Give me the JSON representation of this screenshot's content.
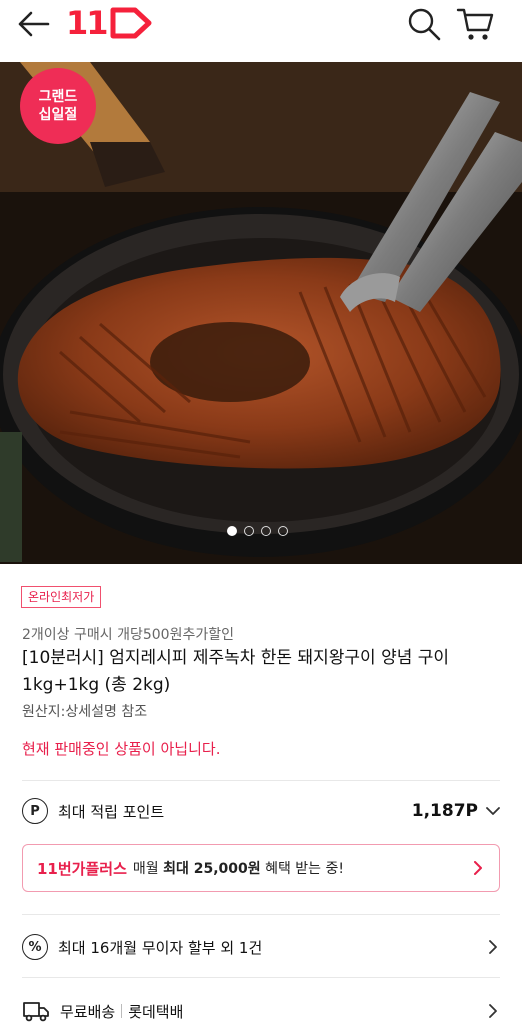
{
  "header": {
    "logo_text": "11",
    "back_icon": "back-arrow-icon",
    "search_icon": "search-icon",
    "cart_icon": "cart-icon"
  },
  "hero": {
    "badge_line1": "그랜드",
    "badge_line2": "십일절",
    "image_count": 4,
    "active_index": 0
  },
  "product": {
    "lowest_tag": "온라인최저가",
    "promo": "2개이상 구매시 개당500원추가할인",
    "title": "[10분러시] 엄지레시피 제주녹차 한돈 돼지왕구이 양념 구이 1kg+1kg (총 2kg)",
    "origin": "원산지:상세설명 참조",
    "status": "현재 판매중인 상품이 아닙니다."
  },
  "points": {
    "icon_text": "P",
    "label": "최대 적립 포인트",
    "value": "1,187P"
  },
  "plus": {
    "brand": "11번가플러스",
    "text_prefix": "매월",
    "text_bold": "최대 25,000원",
    "text_suffix": "혜택 받는 중!"
  },
  "installment": {
    "icon_text": "%",
    "label": "최대 16개월 무이자 할부 외 1건"
  },
  "delivery": {
    "label": "무료배송",
    "carrier": "롯데택배"
  },
  "colors": {
    "brand": "#f5213b",
    "accent_pink": "#e8204c"
  }
}
